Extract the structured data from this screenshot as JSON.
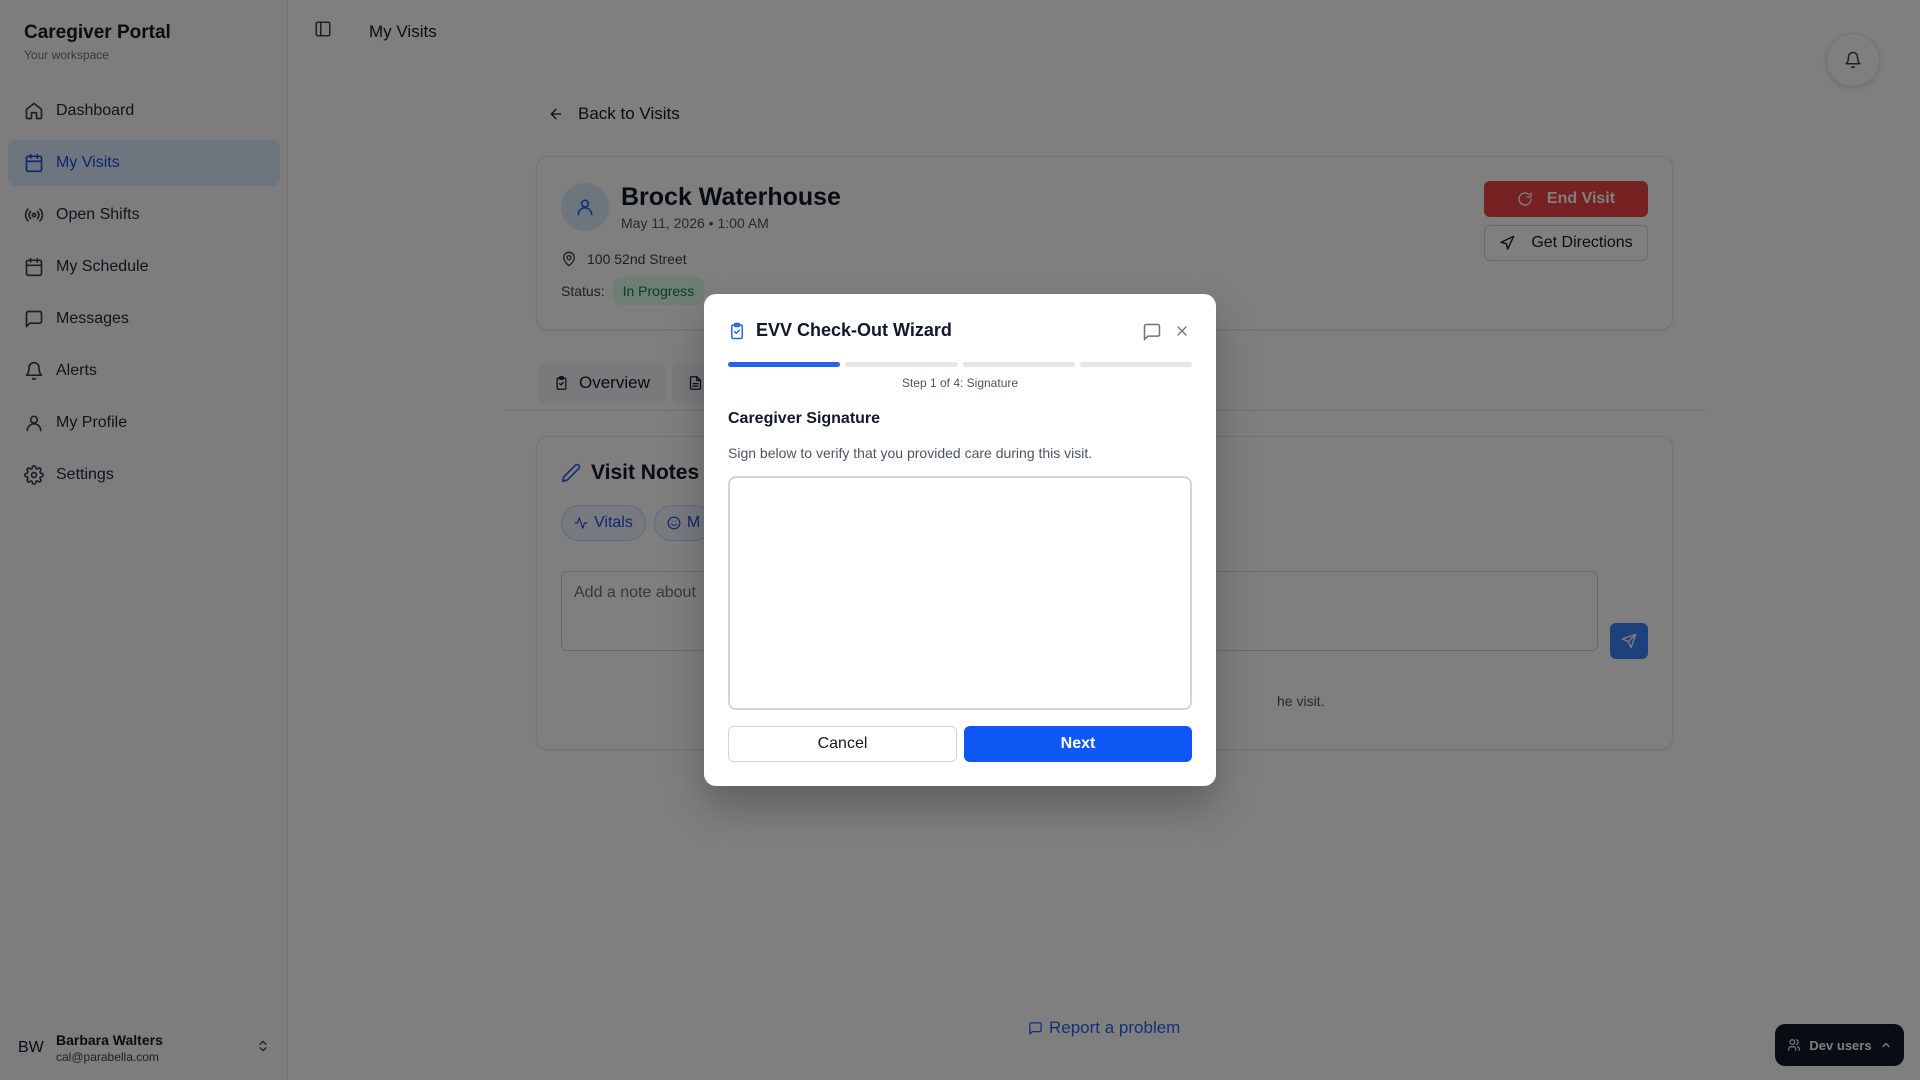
{
  "brand": {
    "title": "Caregiver Portal",
    "subtitle": "Your workspace"
  },
  "sidebar": {
    "items": [
      {
        "label": "Dashboard",
        "icon": "home-icon"
      },
      {
        "label": "My Visits",
        "icon": "calendar-icon",
        "active": true
      },
      {
        "label": "Open Shifts",
        "icon": "broadcast-icon"
      },
      {
        "label": "My Schedule",
        "icon": "calendar-icon"
      },
      {
        "label": "Messages",
        "icon": "message-icon"
      },
      {
        "label": "Alerts",
        "icon": "bell-icon"
      },
      {
        "label": "My Profile",
        "icon": "user-icon"
      },
      {
        "label": "Settings",
        "icon": "gear-icon"
      }
    ]
  },
  "user": {
    "initials": "BW",
    "name": "Barbara Walters",
    "email": "cal@parabella.com"
  },
  "header": {
    "title": "My Visits"
  },
  "main": {
    "back_label": "Back to Visits",
    "visit": {
      "client_name": "Brock Waterhouse",
      "datetime": "May 11, 2026 • 1:00 AM",
      "address": "100 52nd Street",
      "status_label": "Status:",
      "status_value": "In Progress",
      "end_visit_label": "End Visit",
      "directions_label": "Get Directions"
    },
    "tabs": [
      {
        "label": "Overview"
      }
    ],
    "notes": {
      "title": "Visit Notes",
      "chips": [
        {
          "label": "Vitals"
        },
        {
          "label": "M"
        }
      ],
      "placeholder": "Add a note about",
      "helper_text": "he visit."
    },
    "report_label": "Report a problem"
  },
  "dev_users": {
    "label": "Dev users"
  },
  "modal": {
    "title": "EVV Check-Out Wizard",
    "step_text": "Step 1 of 4: Signature",
    "progress": {
      "current_step": 1,
      "total_steps": 4
    },
    "section_title": "Caregiver Signature",
    "description": "Sign below to verify that you provided care during this visit.",
    "cancel_label": "Cancel",
    "next_label": "Next"
  },
  "colors": {
    "accent": "#2563eb",
    "danger": "#ef4444",
    "success_bg": "#dcfce7",
    "success_text": "#15803d",
    "overlay": "rgba(0,0,0,0.5)"
  }
}
